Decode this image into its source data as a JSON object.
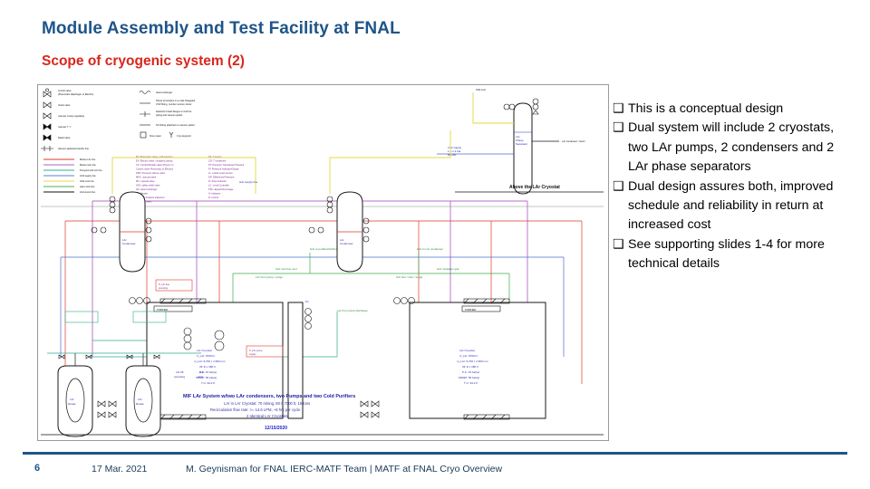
{
  "header": {
    "title": "Module Assembly and Test Facility at FNAL",
    "subtitle": "Scope of cryogenic system (2)",
    "title_color": "#1f5488",
    "subtitle_color": "#d9261c"
  },
  "bullets": [
    {
      "marker": "❑",
      "text": "This is a conceptual design"
    },
    {
      "marker": "❑",
      "text": "Dual system will include 2 cryostats, two LAr pumps, 2 condensers and 2 LAr phase separators"
    },
    {
      "marker": "❑",
      "text": "Dual design assures both, improved schedule and reliability in return at increased cost"
    },
    {
      "marker": "❑",
      "text": "See supporting slides 1-4 for more technical details"
    }
  ],
  "footer": {
    "page_number": "6",
    "date": "17 Mar. 2021",
    "credit": "M. Geynisman for FNAL IERC-MATF Team | MATF at FNAL Cryo Overview",
    "rule_color": "#1f5488"
  },
  "diagram": {
    "caption_title": "MIF LAr System w/two LAr condensers, two Pumps and two Cold Purifiers",
    "caption_line1": "LAr in LAr Cryostat: 70 mlong, 80 t, 7000 lt, 19 tons",
    "caption_line2": "Recirculation flow rate: >= 14.6 LPM, ~8 hrs per cycle",
    "caption_line3": "2 Identical LAr Cryostats",
    "caption_date": "12/15/2020",
    "note_above_cryostat": "Above the LAr Cryostat",
    "legend_symbols": [
      "Control valve (Pneumatic diaphragm or Electric)",
      "Check valve",
      "Manual, 3-way regulating",
      "Manual, T, Y",
      "Relief valve",
      "Vacuum jacketed transfer line"
    ],
    "legend_symbols_right": [
      "Heat exchanger",
      "Piping terminates in a male Swagelok VCR fitting, number version Junior",
      "Dielectric break flanges on both Ar piping and vacuum jacket",
      "KF Fitting attached on vacuum jacket",
      "Flow meter",
      "Cryo keypoint"
    ],
    "legend_lines": [
      {
        "label": "Motive LAr line",
        "color": "#d93a2b"
      },
      {
        "label": "Motive GAr line",
        "color": "#b05fc0"
      },
      {
        "label": "Pumped cold LAr line",
        "color": "#2fae8e"
      },
      {
        "label": "LN2 supply line",
        "color": "#5b7fd4"
      },
      {
        "label": "GN2 vent line",
        "color": "#e3d84a"
      },
      {
        "label": "warm GAr line",
        "color": "#4caf50"
      },
      {
        "label": "Instrument line",
        "color": "#111111"
      }
    ],
    "legend_abbrev_left": [
      "PV: Pneumatic valve, cold warming",
      "EV: Electric valve, cryogenic piping",
      "CV: Control/throttle valve (Pneumatic or Electric)",
      "PRV: Pressure relieve valve",
      "MPV: manual valve",
      "MV: manual valve",
      "SSV: safety relief valve",
      "HX: Heat exchanger",
      "HR: Heater",
      "AMV: Air Ambient Vaporizer",
      "FE: Flow meter"
    ],
    "legend_abbrev_right": [
      "TE: Transmitter",
      "CD: Condenser",
      "PT: Pressure Transducer/Transmitter",
      "PI: Pressure Indicator/Gauge",
      "LL: Liquid Level sensor",
      "DP: Differential Pressure",
      "FI: Flow Indicator",
      "LC: Level Controller",
      "PSC: Cryo/Pressure",
      "H: Indicator",
      "D: Control"
    ],
    "vessel_labels": {
      "cryostat_left": "LAr Cryostat\nV_LAr: 9700 lit\nm_LAr: 9,700 l, 1,500 mm\n33' lit x 180' lt\nP in: 15 bar(a)\nMAWP: 50 bar(a)\nT in: 94.2 K",
      "cryostat_right": "LAr Cryostat\nV_LAr: 9700 lit\nm_LAr: 9,700 l, 1,500 mm\n33' lit x 180' lt\nP in: 15 bar(a)\nMAWP: 50 bar(a)\nT in: 94.2 K",
      "phase_separator": "LAr Phase Separator",
      "condenser_note": "LN2 supply 1.1-1.4 bar 85-100",
      "purifier_left": "PURIFIER",
      "purifier_right": "PURIFIER",
      "dewar_left": "LAr Dewar",
      "dewar_right": "LAr Dewar",
      "dewar_note": "LAr fill / receiving",
      "gar_vent": "GAr vent",
      "gar_to_purifier": "GAr to purifiers",
      "gar_to_condenser": "GAr to LAr condenser",
      "lar_from_pump": "LAr from pump",
      "pump_supply": "P_LAr pump supply",
      "lar_pump_piping": "LAr line piping"
    }
  }
}
